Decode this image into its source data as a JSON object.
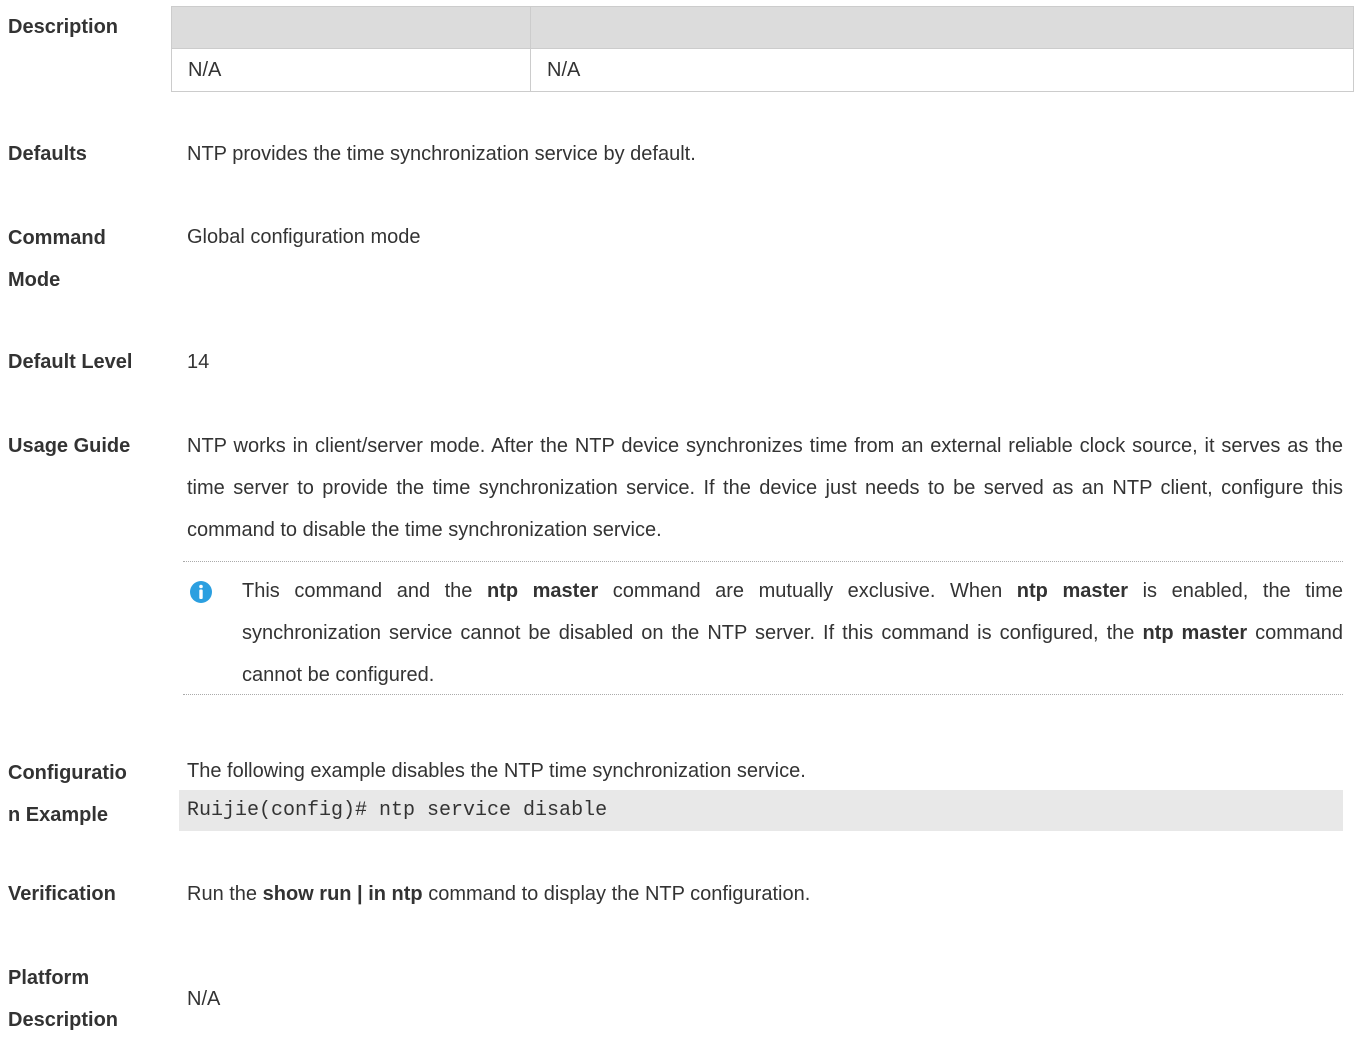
{
  "description": {
    "label": "Description",
    "table": {
      "header": [
        "",
        ""
      ],
      "rows": [
        [
          "N/A",
          "N/A"
        ]
      ]
    }
  },
  "defaults": {
    "label": "Defaults",
    "text": "NTP provides the time synchronization service by default."
  },
  "command_mode": {
    "label_line1": "Command",
    "label_line2": "Mode",
    "text": "Global configuration mode"
  },
  "default_level": {
    "label": "Default Level",
    "text": "14"
  },
  "usage_guide": {
    "label": "Usage Guide",
    "text": "NTP works in client/server mode. After the NTP device synchronizes time from an external reliable clock source, it serves as the time server to provide the time synchronization service. If the device just needs to be served as an NTP client, configure this command to disable the time synchronization service.",
    "note": {
      "icon": "info-icon",
      "part1": "This command and the ",
      "bold1": "ntp master",
      "part2": " command are mutually exclusive. When ",
      "bold2": "ntp master",
      "part3": " is enabled, the time synchronization service cannot be disabled on the NTP server. If this command is configured, the ",
      "bold3": "ntp master",
      "part4": " command cannot be configured."
    }
  },
  "configuration_example": {
    "label_line1": "Configuratio",
    "label_line2": "n Example",
    "text": "The following example disables the NTP time synchronization service.",
    "code": "Ruijie(config)# ntp service disable"
  },
  "verification": {
    "label": "Verification",
    "part1": "Run the ",
    "bold": "show run | in ntp",
    "part2": " command to display the NTP configuration."
  },
  "platform_description": {
    "label_line1": "Platform",
    "label_line2": "Description",
    "text": "N/A"
  },
  "colors": {
    "text": "#333333",
    "table_header_bg": "#dcdcdc",
    "code_bg": "#e8e8e8",
    "info_icon": "#2b9fe0"
  }
}
